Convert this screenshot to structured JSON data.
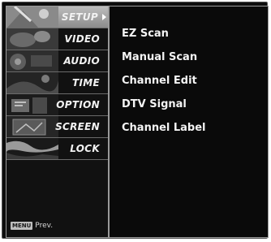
{
  "menu": {
    "items": [
      {
        "label": "SETUP",
        "active": true
      },
      {
        "label": "VIDEO"
      },
      {
        "label": "AUDIO"
      },
      {
        "label": "TIME"
      },
      {
        "label": "OPTION"
      },
      {
        "label": "SCREEN"
      },
      {
        "label": "LOCK"
      }
    ],
    "active_indicator_icon": "chevron-right-icon"
  },
  "submenu": {
    "items": [
      "EZ Scan",
      "Manual Scan",
      "Channel Edit",
      "DTV Signal",
      "Channel Label"
    ]
  },
  "footer": {
    "menu_key": "MENU",
    "prev_label": "Prev."
  },
  "colors": {
    "background": "#0a0a0a",
    "active_item": "#a6a6a6",
    "text": "#f2f2f2",
    "border": "#9a9a9a"
  }
}
